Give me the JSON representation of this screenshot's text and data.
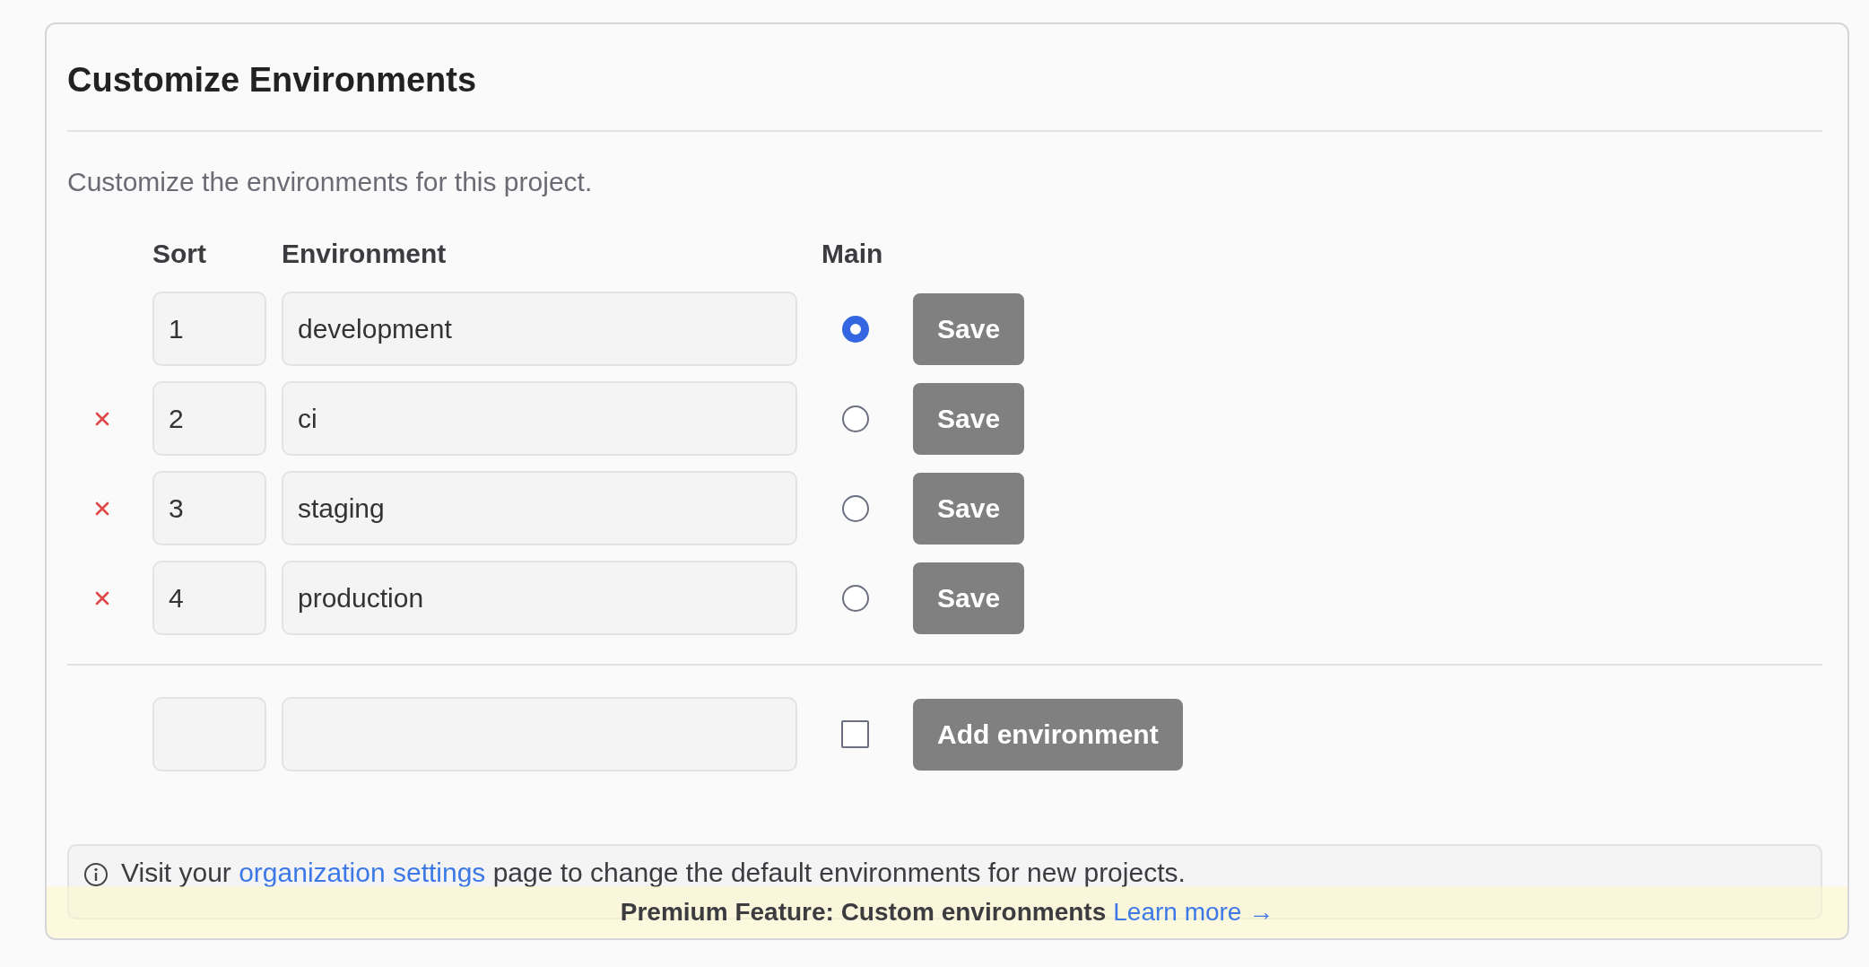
{
  "title": "Customize Environments",
  "description": "Customize the environments for this project.",
  "columns": [
    "Sort",
    "Environment",
    "Main"
  ],
  "environments": [
    {
      "sort": "1",
      "name": "development",
      "main": true,
      "deletable": false,
      "button": "Save"
    },
    {
      "sort": "2",
      "name": "ci",
      "main": false,
      "deletable": true,
      "button": "Save"
    },
    {
      "sort": "3",
      "name": "staging",
      "main": false,
      "deletable": true,
      "button": "Save"
    },
    {
      "sort": "4",
      "name": "production",
      "main": false,
      "deletable": true,
      "button": "Save"
    }
  ],
  "new_environment": {
    "main": false,
    "button": "Add environment"
  },
  "info": {
    "text_before": "Visit your ",
    "link": "organization settings",
    "text_after": " page to change the default environments for new projects."
  },
  "banner": {
    "label": "Premium Feature: Custom environments",
    "link": "Learn more →"
  }
}
